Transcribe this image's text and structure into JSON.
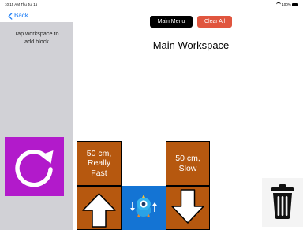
{
  "status_bar": {
    "time": "10:15 AM   Thu Jul 15",
    "right": "100%"
  },
  "nav": {
    "back_label": "Back"
  },
  "sidebar": {
    "hint": "Tap workspace to\nadd block",
    "blocks": [
      {
        "icon": "repeat-icon",
        "color": "#b21acb"
      }
    ]
  },
  "toolbar": {
    "main_menu_label": "Main Menu",
    "clear_all_label": "Clear All"
  },
  "workspace": {
    "title": "Main Workspace",
    "blocks": [
      {
        "label": "50 cm,\nReally\nFast",
        "icon": "arrow-up-icon",
        "color": "#b6580f"
      },
      {
        "icon": "robot-icon",
        "color": "#1474d4"
      },
      {
        "label": "50 cm,\nSlow",
        "icon": "arrow-down-icon",
        "color": "#b6580f"
      }
    ]
  },
  "trash": {
    "icon": "trash-icon"
  }
}
